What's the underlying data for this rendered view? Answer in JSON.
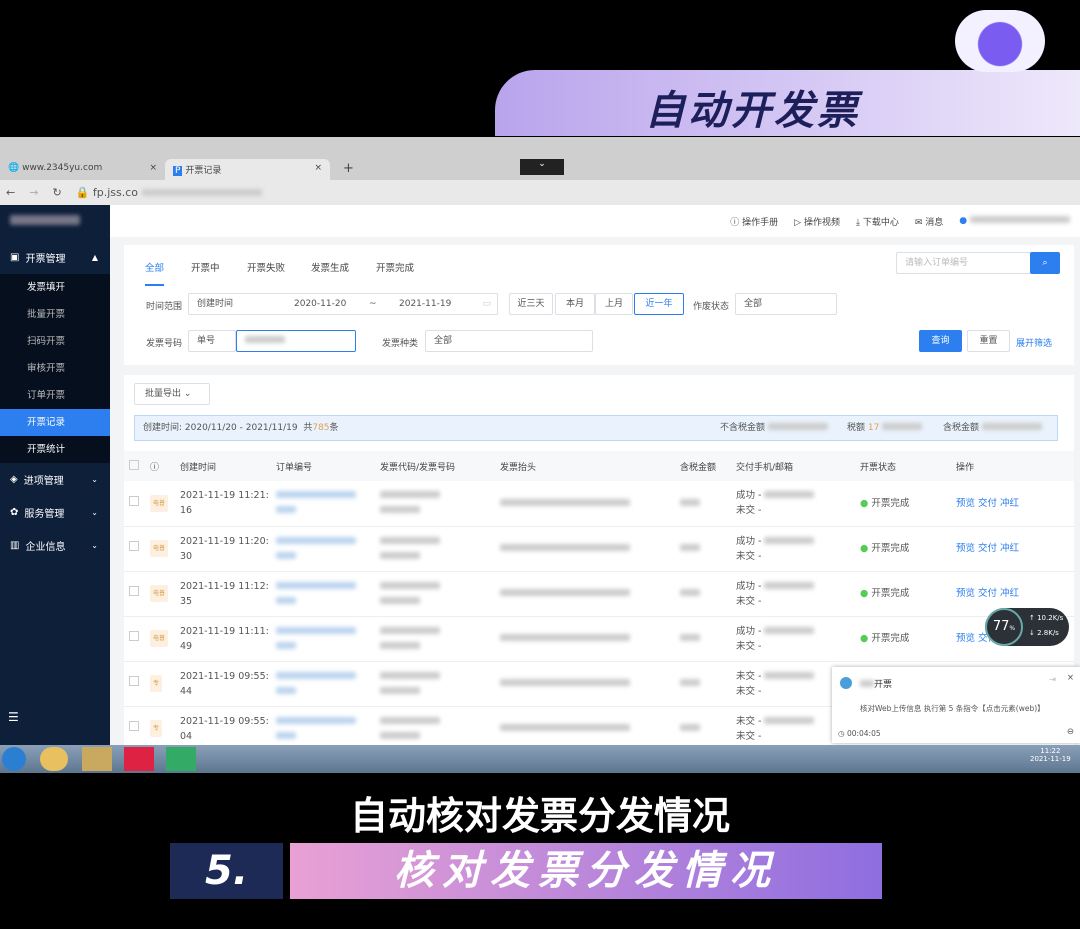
{
  "overlay": {
    "title": "自动开发票",
    "caption": "自动核对发票分发情况",
    "step_number": "5.",
    "step_title": "核对发票分发情况"
  },
  "browser": {
    "tabs": [
      "www.2345yu.com",
      "开票记录"
    ],
    "url": "fp.jss.co"
  },
  "sidebar": {
    "groups": [
      {
        "label": "开票管理",
        "items": [
          "发票填开",
          "批量开票",
          "扫码开票",
          "审核开票",
          "订单开票",
          "开票记录",
          "开票统计"
        ],
        "active": "开票记录"
      },
      {
        "label": "进项管理"
      },
      {
        "label": "服务管理"
      },
      {
        "label": "企业信息"
      }
    ]
  },
  "topbar": {
    "manual": "操作手册",
    "video": "操作视频",
    "download": "下载中心",
    "message": "消息"
  },
  "tabs": [
    "全部",
    "开票中",
    "开票失败",
    "发票生成",
    "开票完成"
  ],
  "search": {
    "placeholder": "请输入订单编号"
  },
  "filters": {
    "time_label": "时间范围",
    "time_type": "创建时间",
    "start": "2020-11-20",
    "sep": "~",
    "end": "2021-11-19",
    "quick": [
      "近三天",
      "本月",
      "上月",
      "近一年"
    ],
    "void_label": "作废状态",
    "void_value": "全部",
    "code_label": "发票号码",
    "code_type": "单号",
    "kind_label": "发票种类",
    "kind_value": "全部",
    "query": "查询",
    "reset": "重置",
    "expand": "展开筛选"
  },
  "export": "批量导出",
  "summary": {
    "text": "创建时间: 2020/11/20 - 2021/11/19",
    "total_prefix": "共",
    "count": "785",
    "total_suffix": "条",
    "untaxed": "不含税金额",
    "tax": "税额",
    "tax_val": "17",
    "taxed": "含税金额"
  },
  "columns": [
    "创建时间",
    "订单编号",
    "发票代码/发票号码",
    "发票抬头",
    "含税金额",
    "交付手机/邮箱",
    "开票状态",
    "操作"
  ],
  "rows": [
    {
      "tag": "电普",
      "time": "2021-11-19 11:21:",
      "sec": "16",
      "d1": "成功 -",
      "d2": "未交 -",
      "status": "开票完成"
    },
    {
      "tag": "电普",
      "time": "2021-11-19 11:20:",
      "sec": "30",
      "d1": "成功 -",
      "d2": "未交 -",
      "status": "开票完成"
    },
    {
      "tag": "电普",
      "time": "2021-11-19 11:12:",
      "sec": "35",
      "d1": "成功 -",
      "d2": "未交 -",
      "status": "开票完成"
    },
    {
      "tag": "电普",
      "time": "2021-11-19 11:11:",
      "sec": "49",
      "d1": "成功 -",
      "d2": "未交 -",
      "status": "开票完成"
    },
    {
      "tag": "专",
      "time": "2021-11-19 09:55:",
      "sec": "44",
      "d1": "未交 -",
      "d2": "未交 -",
      "status": ""
    },
    {
      "tag": "专",
      "time": "2021-11-19 09:55:",
      "sec": "04",
      "d1": "未交 -",
      "d2": "未交 -",
      "status": ""
    }
  ],
  "actions": [
    "预览",
    "交付",
    "冲红"
  ],
  "notification": {
    "title": "开票",
    "body": "核对Web上传信息 执行第 5 条指令【点击元素(web)】",
    "timer": "00:04:05"
  },
  "gauge": {
    "percent": "77",
    "unit": "%",
    "up": "10.2",
    "down": "2.8",
    "rate_unit": "K/s"
  },
  "clock": {
    "time": "11:22",
    "date": "2021-11-19"
  }
}
